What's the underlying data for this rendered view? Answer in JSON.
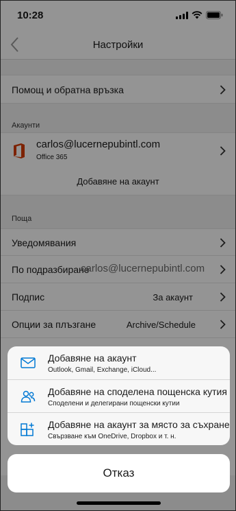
{
  "status_bar": {
    "time": "10:28"
  },
  "nav": {
    "title": "Настройки"
  },
  "help_row": {
    "label": "Помощ и обратна връзка"
  },
  "accounts": {
    "header": "Акаунти",
    "email": "carlos@lucernepubintl.com",
    "type": "Office 365",
    "add_label": "Добавяне на акаунт"
  },
  "mail": {
    "header": "Поща",
    "rows": [
      {
        "label": "Уведомявания",
        "value": ""
      },
      {
        "label": "По подразбиране",
        "value": "carlos@lucernepubintl.com"
      },
      {
        "label": "Подпис",
        "value": "За акаунт"
      },
      {
        "label": "Опции за плъзгане",
        "value": "Archive/Schedule"
      }
    ]
  },
  "sheet": {
    "items": [
      {
        "title": "Добавяне на акаунт",
        "subtitle": "Outlook, Gmail, Exchange, iCloud...",
        "icon": "envelope-icon"
      },
      {
        "title": "Добавяне на споделена пощенска кутия",
        "subtitle": "Споделени и делегирани пощенски кутии",
        "icon": "people-icon"
      },
      {
        "title": "Добавяне на акаунт за място за съхранение",
        "subtitle": "Свързване към OneDrive, Dropbox и т. н.",
        "icon": "grid-plus-icon"
      }
    ],
    "cancel_label": "Отказ"
  },
  "colors": {
    "accent": "#0078d4",
    "office_red": "#d83b01"
  }
}
